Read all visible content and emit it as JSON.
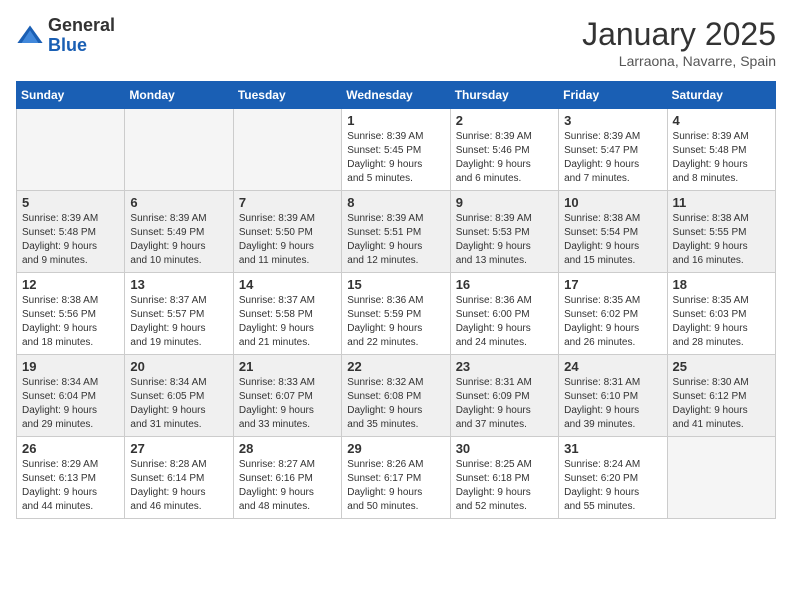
{
  "header": {
    "logo_line1": "General",
    "logo_line2": "Blue",
    "month_title": "January 2025",
    "location": "Larraona, Navarre, Spain"
  },
  "weekdays": [
    "Sunday",
    "Monday",
    "Tuesday",
    "Wednesday",
    "Thursday",
    "Friday",
    "Saturday"
  ],
  "weeks": [
    [
      {
        "day": "",
        "info": ""
      },
      {
        "day": "",
        "info": ""
      },
      {
        "day": "",
        "info": ""
      },
      {
        "day": "1",
        "info": "Sunrise: 8:39 AM\nSunset: 5:45 PM\nDaylight: 9 hours\nand 5 minutes."
      },
      {
        "day": "2",
        "info": "Sunrise: 8:39 AM\nSunset: 5:46 PM\nDaylight: 9 hours\nand 6 minutes."
      },
      {
        "day": "3",
        "info": "Sunrise: 8:39 AM\nSunset: 5:47 PM\nDaylight: 9 hours\nand 7 minutes."
      },
      {
        "day": "4",
        "info": "Sunrise: 8:39 AM\nSunset: 5:48 PM\nDaylight: 9 hours\nand 8 minutes."
      }
    ],
    [
      {
        "day": "5",
        "info": "Sunrise: 8:39 AM\nSunset: 5:48 PM\nDaylight: 9 hours\nand 9 minutes."
      },
      {
        "day": "6",
        "info": "Sunrise: 8:39 AM\nSunset: 5:49 PM\nDaylight: 9 hours\nand 10 minutes."
      },
      {
        "day": "7",
        "info": "Sunrise: 8:39 AM\nSunset: 5:50 PM\nDaylight: 9 hours\nand 11 minutes."
      },
      {
        "day": "8",
        "info": "Sunrise: 8:39 AM\nSunset: 5:51 PM\nDaylight: 9 hours\nand 12 minutes."
      },
      {
        "day": "9",
        "info": "Sunrise: 8:39 AM\nSunset: 5:53 PM\nDaylight: 9 hours\nand 13 minutes."
      },
      {
        "day": "10",
        "info": "Sunrise: 8:38 AM\nSunset: 5:54 PM\nDaylight: 9 hours\nand 15 minutes."
      },
      {
        "day": "11",
        "info": "Sunrise: 8:38 AM\nSunset: 5:55 PM\nDaylight: 9 hours\nand 16 minutes."
      }
    ],
    [
      {
        "day": "12",
        "info": "Sunrise: 8:38 AM\nSunset: 5:56 PM\nDaylight: 9 hours\nand 18 minutes."
      },
      {
        "day": "13",
        "info": "Sunrise: 8:37 AM\nSunset: 5:57 PM\nDaylight: 9 hours\nand 19 minutes."
      },
      {
        "day": "14",
        "info": "Sunrise: 8:37 AM\nSunset: 5:58 PM\nDaylight: 9 hours\nand 21 minutes."
      },
      {
        "day": "15",
        "info": "Sunrise: 8:36 AM\nSunset: 5:59 PM\nDaylight: 9 hours\nand 22 minutes."
      },
      {
        "day": "16",
        "info": "Sunrise: 8:36 AM\nSunset: 6:00 PM\nDaylight: 9 hours\nand 24 minutes."
      },
      {
        "day": "17",
        "info": "Sunrise: 8:35 AM\nSunset: 6:02 PM\nDaylight: 9 hours\nand 26 minutes."
      },
      {
        "day": "18",
        "info": "Sunrise: 8:35 AM\nSunset: 6:03 PM\nDaylight: 9 hours\nand 28 minutes."
      }
    ],
    [
      {
        "day": "19",
        "info": "Sunrise: 8:34 AM\nSunset: 6:04 PM\nDaylight: 9 hours\nand 29 minutes."
      },
      {
        "day": "20",
        "info": "Sunrise: 8:34 AM\nSunset: 6:05 PM\nDaylight: 9 hours\nand 31 minutes."
      },
      {
        "day": "21",
        "info": "Sunrise: 8:33 AM\nSunset: 6:07 PM\nDaylight: 9 hours\nand 33 minutes."
      },
      {
        "day": "22",
        "info": "Sunrise: 8:32 AM\nSunset: 6:08 PM\nDaylight: 9 hours\nand 35 minutes."
      },
      {
        "day": "23",
        "info": "Sunrise: 8:31 AM\nSunset: 6:09 PM\nDaylight: 9 hours\nand 37 minutes."
      },
      {
        "day": "24",
        "info": "Sunrise: 8:31 AM\nSunset: 6:10 PM\nDaylight: 9 hours\nand 39 minutes."
      },
      {
        "day": "25",
        "info": "Sunrise: 8:30 AM\nSunset: 6:12 PM\nDaylight: 9 hours\nand 41 minutes."
      }
    ],
    [
      {
        "day": "26",
        "info": "Sunrise: 8:29 AM\nSunset: 6:13 PM\nDaylight: 9 hours\nand 44 minutes."
      },
      {
        "day": "27",
        "info": "Sunrise: 8:28 AM\nSunset: 6:14 PM\nDaylight: 9 hours\nand 46 minutes."
      },
      {
        "day": "28",
        "info": "Sunrise: 8:27 AM\nSunset: 6:16 PM\nDaylight: 9 hours\nand 48 minutes."
      },
      {
        "day": "29",
        "info": "Sunrise: 8:26 AM\nSunset: 6:17 PM\nDaylight: 9 hours\nand 50 minutes."
      },
      {
        "day": "30",
        "info": "Sunrise: 8:25 AM\nSunset: 6:18 PM\nDaylight: 9 hours\nand 52 minutes."
      },
      {
        "day": "31",
        "info": "Sunrise: 8:24 AM\nSunset: 6:20 PM\nDaylight: 9 hours\nand 55 minutes."
      },
      {
        "day": "",
        "info": ""
      }
    ]
  ]
}
